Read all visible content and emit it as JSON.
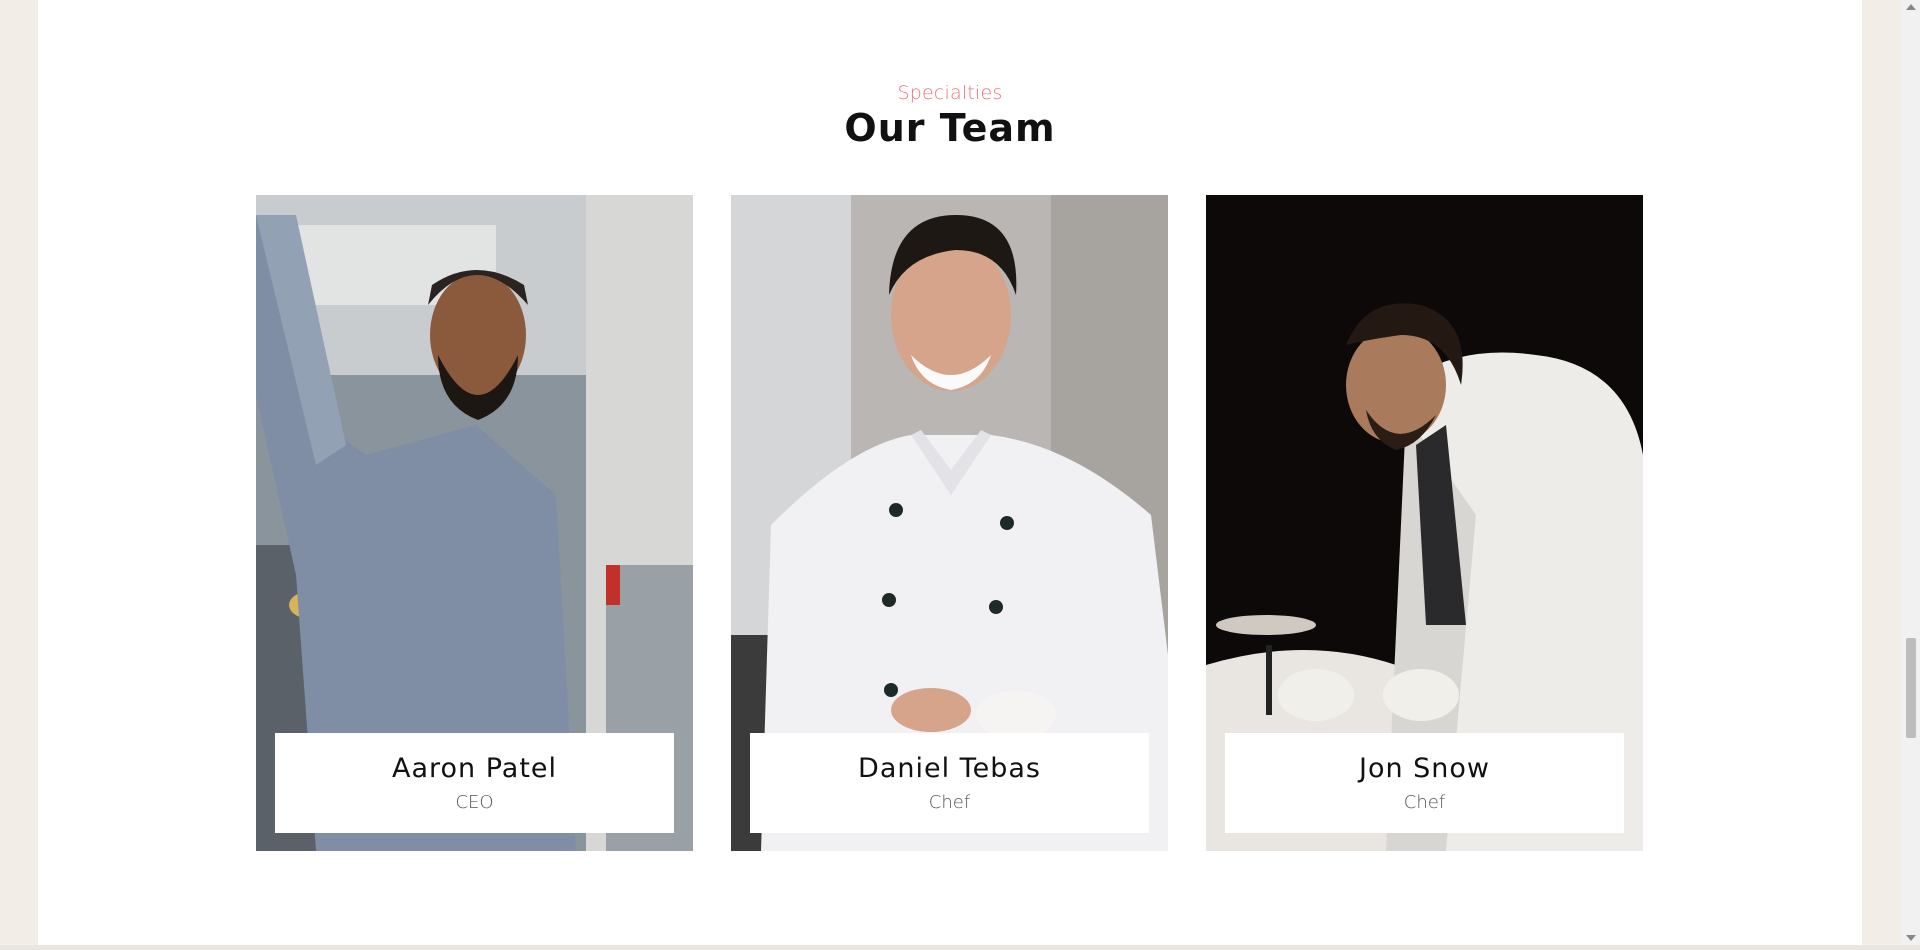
{
  "section": {
    "eyebrow": "Specialties",
    "title": "Our Team"
  },
  "team": [
    {
      "name": "Aaron Patel",
      "role": "CEO",
      "photo": "man-in-striped-shirt-kitchen"
    },
    {
      "name": "Daniel Tebas",
      "role": "Chef",
      "photo": "smiling-chef-white-jacket"
    },
    {
      "name": "Jon Snow",
      "role": "Chef",
      "photo": "chef-plating-dark-kitchen"
    }
  ],
  "colors": {
    "accent": "#f0707a",
    "page_bg": "#f2ede7",
    "content_bg": "#ffffff"
  }
}
